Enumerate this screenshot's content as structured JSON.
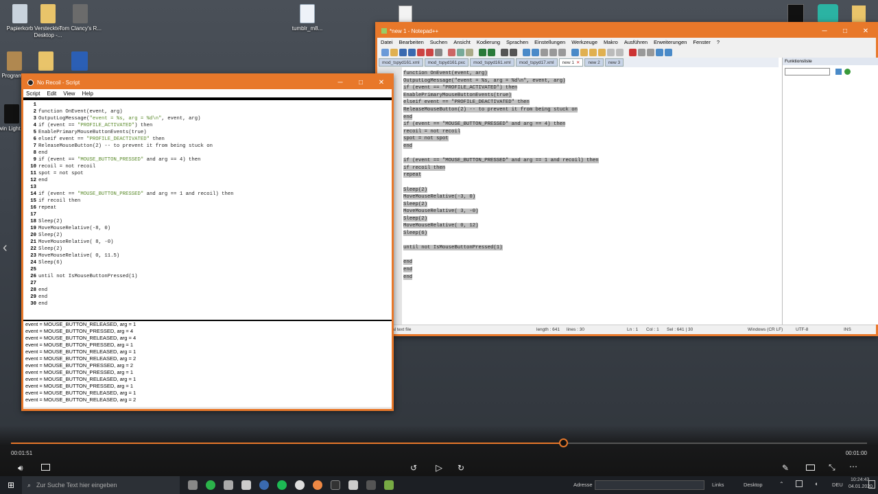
{
  "desktop_icons": [
    {
      "label": "Papierkorb"
    },
    {
      "label": "Versteckter Desktop -..."
    },
    {
      "label": "Tom Clancy's R..."
    },
    {
      "label": "tumblr_m8..."
    },
    {
      "label": "Program..."
    },
    {
      "label": "Glowin Light Bu..."
    }
  ],
  "script_window": {
    "title": "No Recoil - Script",
    "menu": [
      "Script",
      "Edit",
      "View",
      "Help"
    ],
    "lines": [
      [
        "1",
        ""
      ],
      [
        "2",
        "function OnEvent(event, arg)"
      ],
      [
        "3",
        "OutputLogMessage(\"event = %s, arg = %d\\n\", event, arg)"
      ],
      [
        "4",
        "if (event == \"PROFILE_ACTIVATED\") then"
      ],
      [
        "5",
        "EnablePrimaryMouseButtonEvents(true)"
      ],
      [
        "6",
        "elseif event == \"PROFILE_DEACTIVATED\" then"
      ],
      [
        "7",
        "ReleaseMouseButton(2) -- to prevent it from being stuck on"
      ],
      [
        "8",
        "end"
      ],
      [
        "9",
        "if (event == \"MOUSE_BUTTON_PRESSED\" and arg == 4) then"
      ],
      [
        "10",
        "recoil = not recoil"
      ],
      [
        "11",
        "spot = not spot"
      ],
      [
        "12",
        "end"
      ],
      [
        "13",
        ""
      ],
      [
        "14",
        "if (event == \"MOUSE_BUTTON_PRESSED\" and arg == 1 and recoil) then"
      ],
      [
        "15",
        "if recoil then"
      ],
      [
        "16",
        "repeat"
      ],
      [
        "17",
        ""
      ],
      [
        "18",
        "Sleep(2)"
      ],
      [
        "19",
        "MoveMouseRelative(-8, 0)"
      ],
      [
        "20",
        "Sleep(2)"
      ],
      [
        "21",
        "MoveMouseRelative( 8, -0)"
      ],
      [
        "22",
        "Sleep(2)"
      ],
      [
        "23",
        "MoveMouseRelative( 0, 11.5)"
      ],
      [
        "24",
        "Sleep(6)"
      ],
      [
        "25",
        ""
      ],
      [
        "26",
        "until not IsMouseButtonPressed(1)"
      ],
      [
        "27",
        ""
      ],
      [
        "28",
        "end"
      ],
      [
        "29",
        "end"
      ],
      [
        "30",
        "end"
      ]
    ],
    "log": [
      "event = MOUSE_BUTTON_RELEASED, arg = 1",
      "event = MOUSE_BUTTON_PRESSED, arg = 4",
      "event = MOUSE_BUTTON_RELEASED, arg = 4",
      "event = MOUSE_BUTTON_PRESSED, arg = 1",
      "event = MOUSE_BUTTON_RELEASED, arg = 1",
      "event = MOUSE_BUTTON_RELEASED, arg = 2",
      "event = MOUSE_BUTTON_PRESSED, arg = 2",
      "event = MOUSE_BUTTON_PRESSED, arg = 1",
      "event = MOUSE_BUTTON_RELEASED, arg = 1",
      "event = MOUSE_BUTTON_PRESSED, arg = 1",
      "event = MOUSE_BUTTON_RELEASED, arg = 1",
      "event = MOUSE_BUTTON_RELEASED, arg = 2"
    ]
  },
  "notepad": {
    "title": "*new 1 - Notepad++",
    "menu": [
      "Datei",
      "Bearbeiten",
      "Suchen",
      "Ansicht",
      "Kodierung",
      "Sprachen",
      "Einstellungen",
      "Werkzeuge",
      "Makro",
      "Ausführen",
      "Erweiterungen",
      "Fenster",
      "?"
    ],
    "tabs": [
      "mod_tspyd161.xml",
      "mod_tspyd161.pxc",
      "mod_tspyd161.xml",
      "mod_tspyd17.xml",
      "new 1",
      "new 2",
      "new 3"
    ],
    "lines": [
      "function OnEvent(event, arg)",
      "OutputLogMessage(\"event = %s, arg = %d\\n\", event, arg)",
      "if (event == \"PROFILE_ACTIVATED\") then",
      "EnablePrimaryMouseButtonEvents(true)",
      "elseif event == \"PROFILE_DEACTIVATED\" then",
      "ReleaseMouseButton(2) -- to prevent it from being stuck on",
      "end",
      "if (event == \"MOUSE_BUTTON_PRESSED\" and arg == 4) then",
      "recoil = not recoil",
      "spot = not spot",
      "end",
      "",
      "if (event == \"MOUSE_BUTTON_PRESSED\" and arg == 1 and recoil) then",
      "if recoil then",
      "repeat",
      "",
      "Sleep(2)",
      "MoveMouseRelative(-3, 0)",
      "Sleep(2)",
      "MoveMouseRelative( 3, -0)",
      "Sleep(2)",
      "MoveMouseRelative( 0, 12)",
      "Sleep(6)",
      "",
      "until not IsMouseButtonPressed(1)",
      "",
      "end",
      "end",
      "end"
    ],
    "function_list_title": "Funktionsliste",
    "status": {
      "type": "al text file",
      "length": "length : 641",
      "lines": "lines : 30",
      "ln": "Ln : 1",
      "col": "Col : 1",
      "sel": "Sel : 641 | 30",
      "eol": "Windows (CR LF)",
      "enc": "UTF-8",
      "ins": "INS"
    }
  },
  "player": {
    "time_current": "00:01:51",
    "time_total": "00:01:00",
    "progress": 0.645
  },
  "taskbar": {
    "search_placeholder": "Zur Suche Text hier eingeben",
    "address_label": "Adresse",
    "links_label": "Links",
    "desktop_label": "Desktop",
    "lang": "DEU",
    "time": "10:24:43",
    "date": "04.01.2020"
  },
  "colors": {
    "accent": "#e8782a",
    "selection": "#c0c0c0"
  }
}
